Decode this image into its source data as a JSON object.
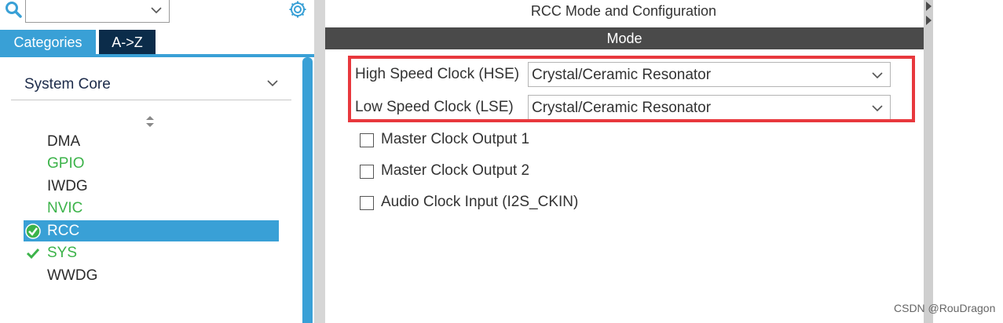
{
  "search": {
    "value": ""
  },
  "tabs": {
    "categories": "Categories",
    "az": "A->Z"
  },
  "category": {
    "label": "System Core"
  },
  "items": [
    {
      "label": "DMA",
      "status": "none"
    },
    {
      "label": "GPIO",
      "status": "configured"
    },
    {
      "label": "IWDG",
      "status": "none"
    },
    {
      "label": "NVIC",
      "status": "configured"
    },
    {
      "label": "RCC",
      "status": "selected"
    },
    {
      "label": "SYS",
      "status": "check"
    },
    {
      "label": "WWDG",
      "status": "none"
    }
  ],
  "panel": {
    "title": "RCC Mode and Configuration",
    "mode_header": "Mode"
  },
  "fields": {
    "hse": {
      "label": "High Speed Clock (HSE)",
      "value": "Crystal/Ceramic Resonator"
    },
    "lse": {
      "label": "Low Speed Clock (LSE)",
      "value": "Crystal/Ceramic Resonator"
    }
  },
  "checkboxes": [
    {
      "label": "Master Clock Output 1",
      "checked": false
    },
    {
      "label": "Master Clock Output 2",
      "checked": false
    },
    {
      "label": "Audio Clock Input (I2S_CKIN)",
      "checked": false
    }
  ],
  "watermark": "CSDN @RouDragon",
  "colors": {
    "accent": "#39a0d6",
    "dark_tab": "#0b2c4a",
    "mode_bar": "#4a4a4a",
    "highlight": "#e8383d",
    "green": "#3cb34a"
  }
}
